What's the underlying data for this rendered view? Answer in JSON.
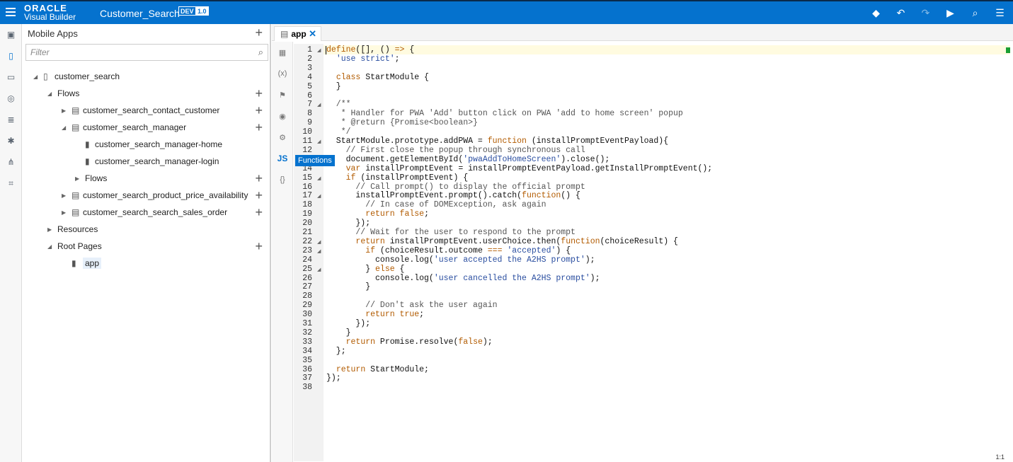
{
  "header": {
    "logo_line1": "ORACLE",
    "logo_line2": "Visual Builder",
    "app_name": "Customer_Search",
    "badge_env": "DEV",
    "badge_version": "1.0",
    "accent": "#0572ce"
  },
  "navigator": {
    "title": "Mobile Apps",
    "filter_placeholder": "Filter",
    "tree": [
      {
        "label": "customer_search",
        "level": 0,
        "icon": "phone-icon",
        "expanded": true,
        "add": false
      },
      {
        "label": "Flows",
        "level": 1,
        "icon": "",
        "expanded": true,
        "add": true
      },
      {
        "label": "customer_search_contact_customer",
        "level": 2,
        "icon": "flow-icon",
        "expanded": false,
        "add": true
      },
      {
        "label": "customer_search_manager",
        "level": 2,
        "icon": "flow-icon",
        "expanded": true,
        "add": true
      },
      {
        "label": "customer_search_manager-home",
        "level": 3,
        "icon": "page-icon",
        "expanded": null,
        "add": false
      },
      {
        "label": "customer_search_manager-login",
        "level": 3,
        "icon": "page-icon",
        "expanded": null,
        "add": false
      },
      {
        "label": "Flows",
        "level": 3,
        "icon": "",
        "expanded": false,
        "add": true
      },
      {
        "label": "customer_search_product_price_availability",
        "level": 2,
        "icon": "flow-icon",
        "expanded": false,
        "add": true
      },
      {
        "label": "customer_search_search_sales_order",
        "level": 2,
        "icon": "flow-icon",
        "expanded": false,
        "add": true
      },
      {
        "label": "Resources",
        "level": 1,
        "icon": "",
        "expanded": false,
        "add": false
      },
      {
        "label": "Root Pages",
        "level": 1,
        "icon": "",
        "expanded": true,
        "add": true
      },
      {
        "label": "app",
        "level": 2,
        "icon": "page-icon",
        "expanded": null,
        "add": false,
        "selected": true
      }
    ]
  },
  "editor": {
    "tab_label": "app",
    "tooltip": "Functions",
    "js_label": "JS",
    "cursor_pos": "1:1",
    "folds": [
      1,
      7,
      11,
      15,
      17,
      22,
      23,
      25
    ],
    "lines": [
      "define([], () => {",
      "  'use strict';",
      "",
      "  class StartModule {",
      "  }",
      "",
      "  /**",
      "   * Handler for PWA 'Add' button click on PWA 'add to home screen' popup",
      "   * @return {Promise<boolean>}",
      "   */",
      "  StartModule.prototype.addPWA = function (installPromptEventPayload){",
      "    // First close the popup through synchronous call",
      "    document.getElementById('pwaAddToHomeScreen').close();",
      "    var installPromptEvent = installPromptEventPayload.getInstallPromptEvent();",
      "    if (installPromptEvent) {",
      "      // Call prompt() to display the official prompt",
      "      installPromptEvent.prompt().catch(function() {",
      "        // In case of DOMException, ask again",
      "        return false;",
      "      });",
      "      // Wait for the user to respond to the prompt",
      "      return installPromptEvent.userChoice.then(function(choiceResult) {",
      "        if (choiceResult.outcome === 'accepted') {",
      "          console.log('user accepted the A2HS prompt');",
      "        } else {",
      "          console.log('user cancelled the A2HS prompt');",
      "        }",
      "",
      "        // Don't ask the user again",
      "        return true;",
      "      });",
      "    }",
      "    return Promise.resolve(false);",
      "  };",
      "",
      "  return StartModule;",
      "});",
      ""
    ]
  }
}
